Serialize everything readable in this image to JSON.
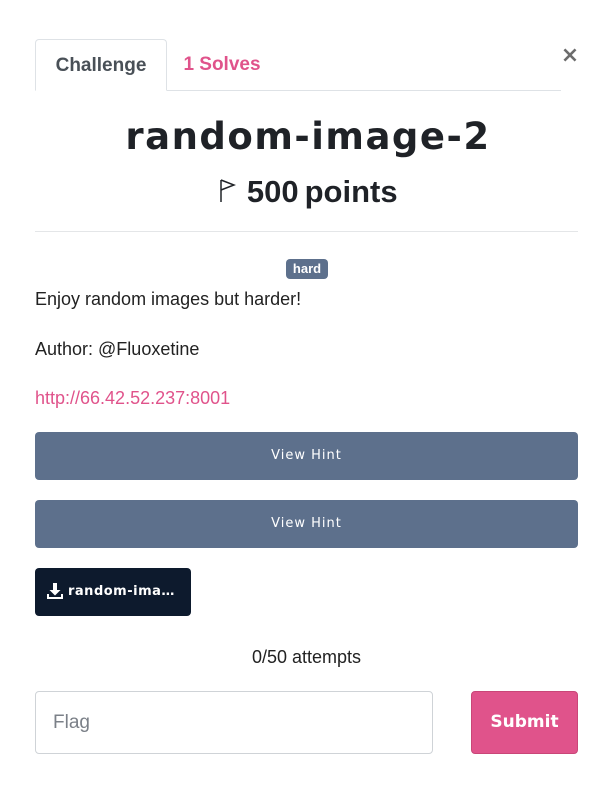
{
  "modal": {
    "close_symbol": "×"
  },
  "tabs": [
    {
      "label": "Challenge",
      "active": true
    },
    {
      "label": "1 Solves",
      "active": false
    }
  ],
  "challenge": {
    "name": "random-image-2",
    "points_value": "500",
    "points_unit": "points",
    "points_icon": "flag-icon",
    "difficulty_badge": "hard",
    "description_lines": [
      "Enjoy random images but harder!",
      "Author: @Fluoxetine"
    ],
    "link": "http://66.42.52.237:8001"
  },
  "hints": [
    {
      "label": "View Hint"
    },
    {
      "label": "View Hint"
    }
  ],
  "files": [
    {
      "label": "random-imag...",
      "icon": "download-icon"
    }
  ],
  "attempts_text": "0/50 attempts",
  "flag_form": {
    "input_value": "",
    "placeholder": "Flag",
    "submit_label": "Submit"
  },
  "colors": {
    "accent": "#e0538b",
    "hint_button": "#5d708c",
    "file_button": "#0d1a2d",
    "badge": "#5d708c"
  }
}
